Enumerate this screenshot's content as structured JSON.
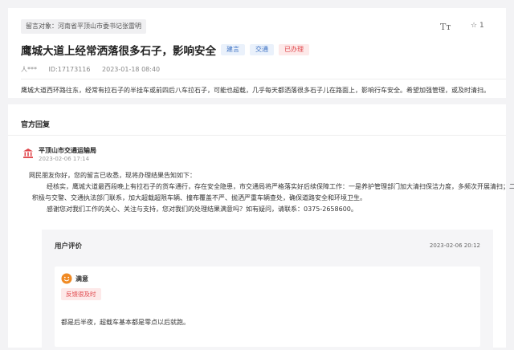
{
  "post": {
    "target": "留言对象：河南省平顶山市委书记张雷明",
    "font_size_icon": "Tт",
    "like_icon": "☆",
    "like_count": "1",
    "title": "鹰城大道上经常洒落很多石子，影响安全",
    "tags": [
      "建言",
      "交通",
      "已办理"
    ],
    "author": "人***",
    "id_label": "ID:17173116",
    "date": "2023-01-18 08:40",
    "content": "鹰城大道西环路往东，经常有拉石子的半挂车或前四后八车拉石子，可能也超载，几乎每天都洒落很多石子儿在路面上，影响行车安全。希望加强管理，或及时清扫。"
  },
  "reply": {
    "heading": "官方回复",
    "org_icon": "government-building-icon",
    "org_name": "平顶山市交通运输局",
    "org_time": "2023-02-06 17:14",
    "lines": [
      "网民朋友你好，您的留言已收悉，现将办理结果告知如下：",
      "经核实，鹰城大道最西段晚上有拉石子的货车通行，存在安全隐患，市交通局将严格落实好后续保障工作：一是养护管理部门加大清扫保洁力度，多频次开展清扫；二是",
      "积极与交警、交通执法部门联系，加大超载超限车辆、撞布覆盖不严、抛洒严重车辆查处，确保道路安全和环境卫生。",
      "感谢您对我们工作的关心、关注与支持，您对我们的处理结果满意吗？如有疑问，请联系：0375-2658600。"
    ]
  },
  "evaluation": {
    "title": "用户评价",
    "time": "2023-02-06 20:12",
    "face_icon": "smiley-face-icon",
    "satisfaction": "满意",
    "feedback_tag": "反馈很及时",
    "comment": "都是后半夜，超载车基本都是零点以后就跑。"
  },
  "colors": {
    "accent_red": "#e0474c",
    "tag_blue": "#3d72c4",
    "face_orange": "#f08a24"
  }
}
